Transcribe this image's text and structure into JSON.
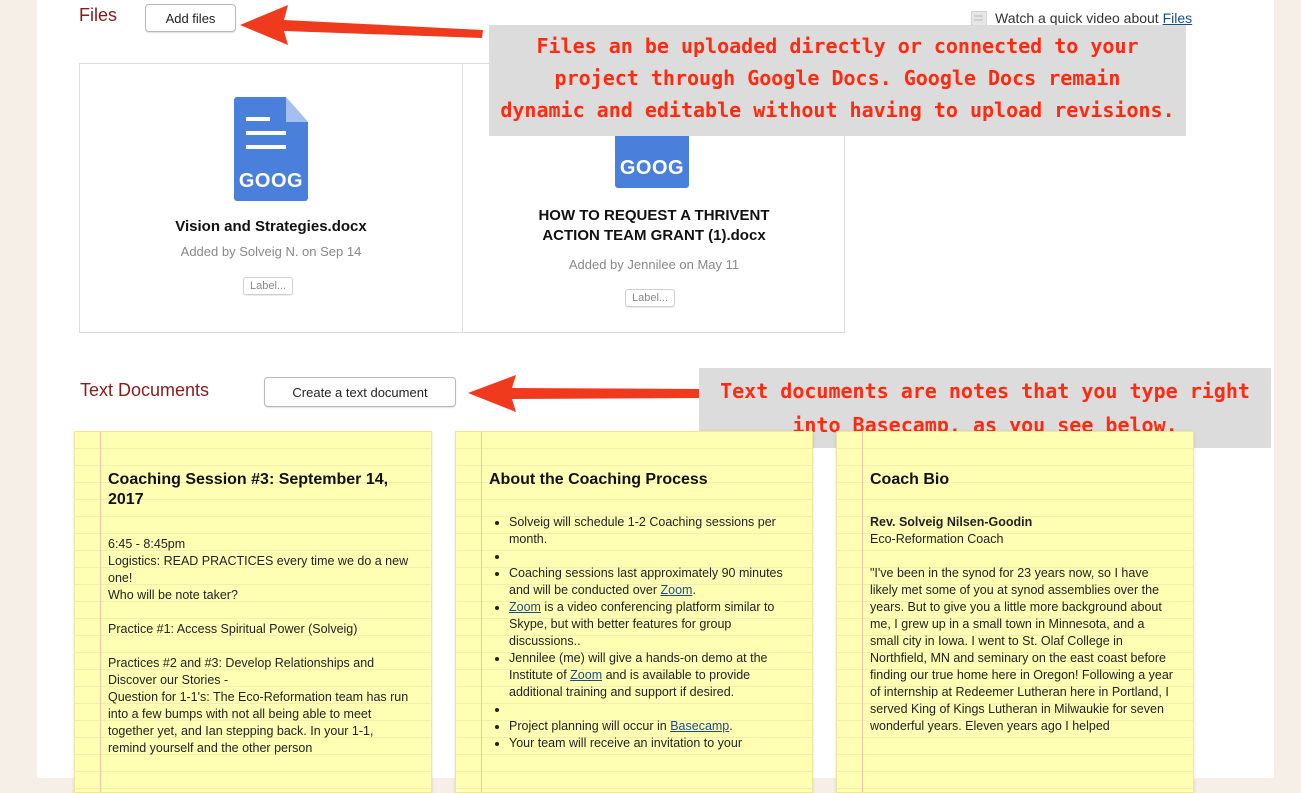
{
  "files_section": {
    "title": "Files",
    "add_button": "Add files",
    "video_link_prefix": "Watch a quick video about ",
    "video_link_word": "Files",
    "files": [
      {
        "icon": "google-doc-icon",
        "icon_label": "GOOG",
        "name": "Vision and Strategies.docx",
        "meta": "Added by Solveig N. on Sep 14",
        "label_button": "Label..."
      },
      {
        "icon": "google-doc-icon",
        "icon_label": "GOOG",
        "name_line1": "HOW TO REQUEST A THRIVENT",
        "name_line2": "ACTION TEAM GRANT (1).docx",
        "meta": "Added by Jennilee on May 11",
        "label_button": "Label..."
      }
    ]
  },
  "callouts": {
    "files": {
      "line1": "Files an be uploaded directly or connected to your",
      "line2": "project through Google Docs. Google Docs remain",
      "line3": "dynamic and editable without having to upload revisions."
    },
    "text_docs": {
      "line1": "Text documents are notes that you type right",
      "line2": "into Basecamp, as you see below."
    },
    "text_color": "#ff2a10",
    "arrow_color": "#f03a1e"
  },
  "text_docs_section": {
    "title": "Text Documents",
    "create_button": "Create a text document"
  },
  "notes": [
    {
      "title": "Coaching Session #3: September 14, 2017",
      "lines": [
        "6:45 - 8:45pm",
        "Logistics: READ PRACTICES every time we do a new one!",
        "Who will be note taker?",
        "",
        "Practice #1: Access Spiritual Power (Solveig)",
        "",
        "Practices #2 and #3: Develop Relationships and Discover our Stories -",
        "Question for 1-1's: The Eco-Reformation team has run into a few bumps with not all being able to meet together yet, and Ian stepping back. In your 1-1, remind yourself and the other person"
      ]
    },
    {
      "title": "About the Coaching Process",
      "items": [
        {
          "text": "Solveig will schedule 1-2 Coaching sessions per month."
        },
        {
          "text": ""
        },
        {
          "pre": "Coaching sessions last approximately 90 minutes and will be conducted over ",
          "link": "Zoom",
          "post": "."
        },
        {
          "link": "Zoom",
          "post": " is a video conferencing platform similar to Skype, but with better features for group discussions.."
        },
        {
          "pre": "Jennilee (me) will give a hands-on demo at the Institute of ",
          "link": "Zoom",
          "post": " and is available to provide additional training and support if desired."
        },
        {
          "text": ""
        },
        {
          "pre": "Project planning will occur in ",
          "link": "Basecamp",
          "post": "."
        },
        {
          "text": "Your team will receive an invitation to your"
        }
      ]
    },
    {
      "title": "Coach Bio",
      "name": "Rev. Solveig Nilsen-Goodin",
      "role": "Eco-Reformation Coach",
      "bio": "\"I've been in the synod for 23 years now, so I have likely met some of you at synod assemblies over the years. But to give you a little more background about me, I grew up in a small town in Minnesota, and a small city in Iowa. I went to St. Olaf College in Northfield, MN and seminary on the east coast before finding our true home here in Oregon! Following a year of internship at Redeemer Lutheran here in Portland, I served King of Kings Lutheran in Milwaukie for seven wonderful years. Eleven years ago I helped"
    }
  ]
}
